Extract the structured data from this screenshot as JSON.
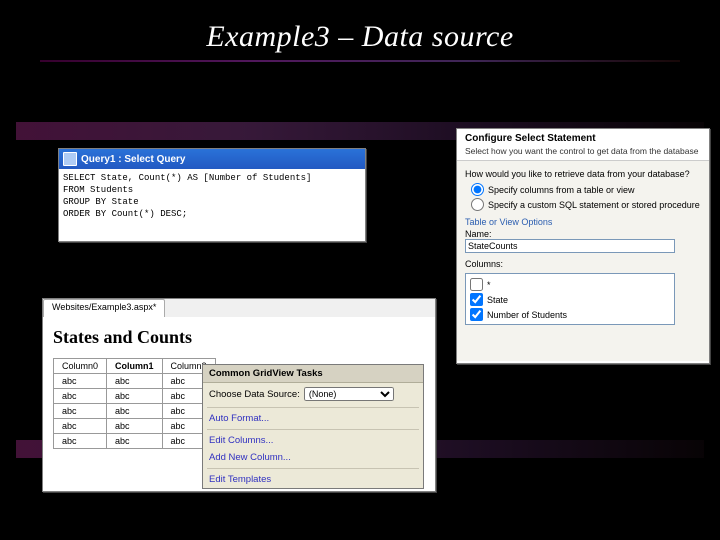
{
  "slide": {
    "title": "Example3 – Data source"
  },
  "sqlWindow": {
    "title": "Query1 : Select Query",
    "sql": "SELECT State, Count(*) AS [Number of Students]\nFROM Students\nGROUP BY State\nORDER BY Count(*) DESC;"
  },
  "designer": {
    "tab_label": "Websites/Example3.aspx*",
    "heading": "States and Counts",
    "grid": {
      "columns": [
        "Column0",
        "Column1",
        "Column2"
      ],
      "cell": "abc",
      "rows": 5
    }
  },
  "smartTag": {
    "title": "Common GridView Tasks",
    "datasource_label": "Choose Data Source:",
    "datasource_value": "(None)",
    "links": {
      "autoformat": "Auto Format...",
      "editcols": "Edit Columns...",
      "addcol": "Add New Column...",
      "edittmpl": "Edit Templates"
    }
  },
  "configure": {
    "title": "Configure Select Statement",
    "subtitle": "Select how you want the control to get data from the database",
    "question": "How would you like to retrieve data from your database?",
    "opt_table": "Specify columns from a table or view",
    "opt_sql": "Specify a custom SQL statement or stored procedure",
    "section": "Table or View Options",
    "name_label": "Name:",
    "name_value": "StateCounts",
    "columns_label": "Columns:",
    "col_all": "*",
    "col_state": "State",
    "col_num": "Number of Students"
  }
}
